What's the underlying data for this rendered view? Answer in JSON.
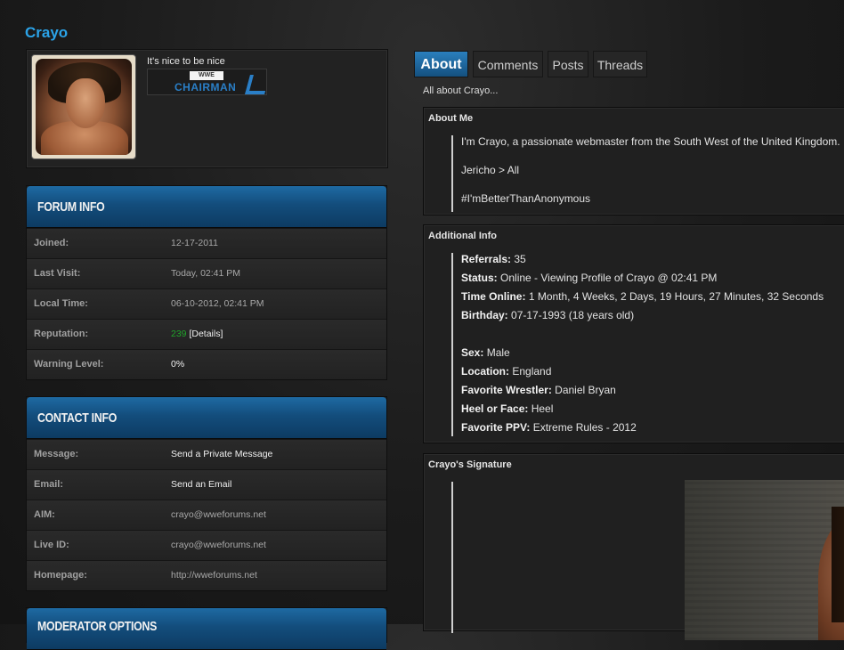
{
  "profile": {
    "username": "Crayo",
    "usertitle": "It's nice to be nice",
    "badge": {
      "top": "WWE",
      "text": "CHAIRMAN"
    }
  },
  "forum_info": {
    "title": "FORUM INFO",
    "rows": [
      {
        "label": "Joined:",
        "value": "12-17-2011"
      },
      {
        "label": "Last Visit:",
        "value": "Today, 02:41 PM"
      },
      {
        "label": "Local Time:",
        "value": "06-10-2012, 02:41 PM"
      },
      {
        "label": "Reputation:",
        "rep_value": "239",
        "rep_link": "[Details]"
      },
      {
        "label": "Warning Level:",
        "value": "0%"
      }
    ]
  },
  "contact_info": {
    "title": "CONTACT INFO",
    "rows": [
      {
        "label": "Message:",
        "value": "Send a Private Message"
      },
      {
        "label": "Email:",
        "value": "Send an Email"
      },
      {
        "label": "AIM:",
        "value": "crayo@wweforums.net"
      },
      {
        "label": "Live ID:",
        "value": "crayo@wweforums.net"
      },
      {
        "label": "Homepage:",
        "value": "http://wweforums.net"
      }
    ]
  },
  "moderator_options": {
    "title": "MODERATOR OPTIONS"
  },
  "tabs": [
    {
      "label": "About",
      "active": true
    },
    {
      "label": "Comments"
    },
    {
      "label": "Posts"
    },
    {
      "label": "Threads"
    }
  ],
  "tab_subtitle": "All about Crayo...",
  "about_me": {
    "title": "About Me",
    "lines": [
      "I'm Crayo, a passionate webmaster from the South West of the United Kingdom.",
      "Jericho > All",
      "#I'mBetterThanAnonymous"
    ]
  },
  "additional_info": {
    "title": "Additional Info",
    "fields": [
      {
        "label": "Referrals:",
        "value": "35"
      },
      {
        "label": "Status:",
        "value": "Online - Viewing Profile of Crayo @ 02:41 PM"
      },
      {
        "label": "Time Online:",
        "value": "1 Month, 4 Weeks, 2 Days, 19 Hours, 27 Minutes, 32 Seconds"
      },
      {
        "label": "Birthday:",
        "value": "07-17-1993 (18 years old)"
      },
      {
        "label": "Sex:",
        "value": "Male"
      },
      {
        "label": "Location:",
        "value": "England"
      },
      {
        "label": "Favorite Wrestler:",
        "value": "Daniel Bryan"
      },
      {
        "label": "Heel or Face:",
        "value": "Heel"
      },
      {
        "label": "Favorite PPV:",
        "value": "Extreme Rules - 2012"
      }
    ]
  },
  "signature": {
    "title": "Crayo's Signature"
  },
  "colors": {
    "accent": "#2ba3e8",
    "header_blue": "#134d7c",
    "reputation_green": "#20a32a"
  }
}
